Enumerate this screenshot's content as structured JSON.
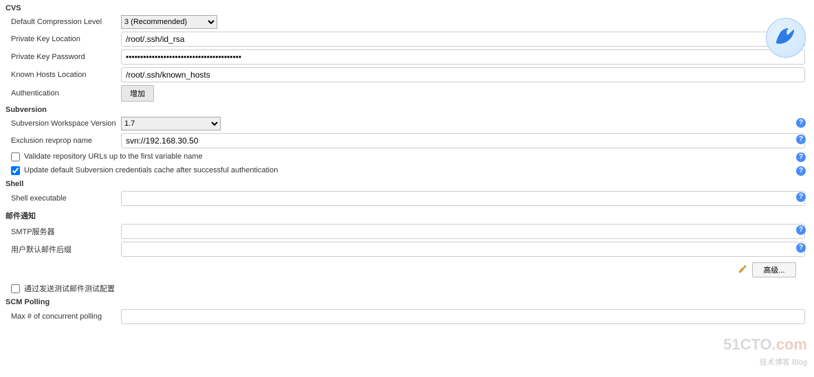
{
  "cvs": {
    "title": "CVS",
    "compression_label": "Default Compression Level",
    "compression_value": "3 (Recommended)",
    "private_key_loc_label": "Private Key Location",
    "private_key_loc_value": "/root/.ssh/id_rsa",
    "private_key_pw_label": "Private Key Password",
    "private_key_pw_value": "••••••••••••••••••••••••••••••••••••••••",
    "known_hosts_label": "Known Hosts Location",
    "known_hosts_value": "/root/.ssh/known_hosts",
    "auth_label": "Authentication",
    "add_button": "增加"
  },
  "svn": {
    "title": "Subversion",
    "workspace_ver_label": "Subversion Workspace Version",
    "workspace_ver_value": "1.7",
    "exclusion_label": "Exclusion revprop name",
    "exclusion_value": "svn://192.168.30.50",
    "validate_label": "Validate repository URLs up to the first variable name",
    "validate_checked": false,
    "update_cache_label": "Update default Subversion credentials cache after successful authentication",
    "update_cache_checked": true
  },
  "shell": {
    "title": "Shell",
    "exec_label": "Shell executable",
    "exec_value": ""
  },
  "mail": {
    "title": "邮件通知",
    "smtp_label": "SMTP服务器",
    "smtp_value": "",
    "suffix_label": "用户默认邮件后缀",
    "suffix_value": "",
    "test_label": "通过发送测试邮件测试配置",
    "test_checked": false,
    "advanced_button": "高级..."
  },
  "scm": {
    "title": "SCM Polling",
    "max_label": "Max # of concurrent polling",
    "max_value": ""
  },
  "watermark": {
    "main": "51CTO",
    "dot": ".com",
    "sub": "技术博客",
    "blog": "Blog"
  }
}
